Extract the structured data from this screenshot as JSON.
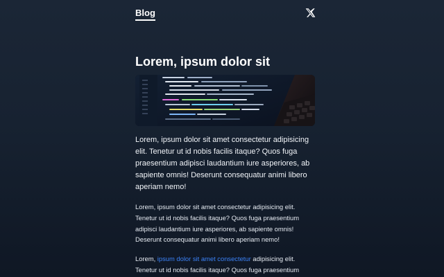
{
  "nav": {
    "blog_label": "Blog",
    "x_icon": "x-logo-icon"
  },
  "article": {
    "title": "Lorem, ipsum dolor sit",
    "hero_image": "code-editor-laptop-photo",
    "lead": "Lorem, ipsum dolor sit amet consectetur adipisicing elit. Tenetur ut id nobis facilis itaque? Quos fuga praesentium adipisci laudantium iure asperiores, ab sapiente omnis! Deserunt consequatur animi libero aperiam nemo!",
    "paragraph_1": "Lorem, ipsum dolor sit amet consectetur adipisicing elit. Tenetur ut id nobis facilis itaque? Quos fuga praesentium adipisci laudantium iure asperiores, ab sapiente omnis! Deserunt consequatur animi libero aperiam nemo!",
    "paragraph_2": {
      "before": "Lorem, ",
      "link": "ipsum dolor sit amet consectetur",
      "after": " adipisicing elit. Tenetur ut id nobis facilis itaque? Quos fuga praesentium adipisci laudantium iure asperiores, ab sapiente omnis!"
    }
  },
  "colors": {
    "background_top": "#1b2636",
    "background_bottom": "#0f1724",
    "text": "#ffffff",
    "link": "#3b82f6"
  }
}
